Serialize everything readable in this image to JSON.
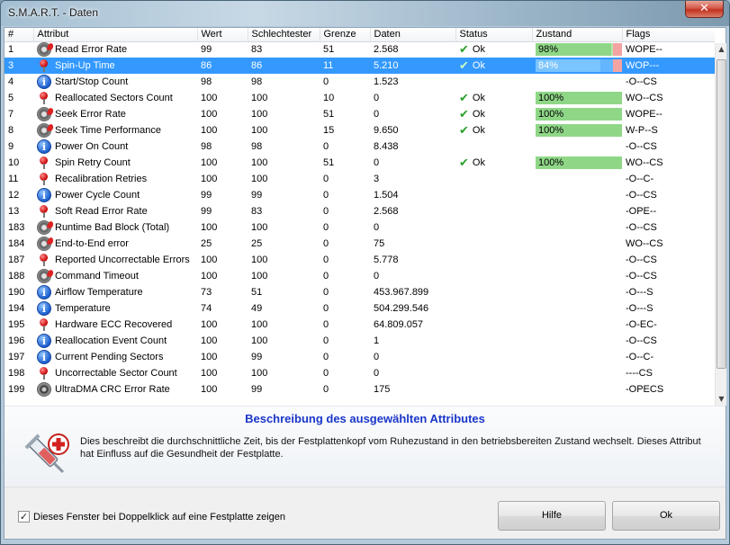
{
  "window": {
    "title": "S.M.A.R.T. - Daten",
    "close_label": "✕"
  },
  "table": {
    "columns": [
      "#",
      "Attribut",
      "Wert",
      "Schlechtester",
      "Grenze",
      "Daten",
      "Status",
      "Zustand",
      "Flags"
    ],
    "rows": [
      {
        "id": "1",
        "icon": "gear-icon",
        "attr": "Read Error Rate",
        "wert": "99",
        "worst": "83",
        "grenze": "51",
        "daten": "2.568",
        "status": "Ok",
        "zustand": "98%",
        "zustand_value": 0.98,
        "flags": "WOPE--"
      },
      {
        "id": "3",
        "icon": "pin-icon",
        "attr": "Spin-Up Time",
        "wert": "86",
        "worst": "86",
        "grenze": "11",
        "daten": "5.210",
        "status": "Ok",
        "zustand": "84%",
        "zustand_value": 0.84,
        "flags": "WOP---",
        "selected": true
      },
      {
        "id": "4",
        "icon": "info-icon",
        "attr": "Start/Stop Count",
        "wert": "98",
        "worst": "98",
        "grenze": "0",
        "daten": "1.523",
        "status": "",
        "zustand": "",
        "flags": "-O--CS"
      },
      {
        "id": "5",
        "icon": "pin-icon",
        "attr": "Reallocated Sectors Count",
        "wert": "100",
        "worst": "100",
        "grenze": "10",
        "daten": "0",
        "status": "Ok",
        "zustand": "100%",
        "zustand_value": 1.0,
        "flags": "WO--CS"
      },
      {
        "id": "7",
        "icon": "gear-icon",
        "attr": "Seek Error Rate",
        "wert": "100",
        "worst": "100",
        "grenze": "51",
        "daten": "0",
        "status": "Ok",
        "zustand": "100%",
        "zustand_value": 1.0,
        "flags": "WOPE--"
      },
      {
        "id": "8",
        "icon": "gear-icon",
        "attr": "Seek Time Performance",
        "wert": "100",
        "worst": "100",
        "grenze": "15",
        "daten": "9.650",
        "status": "Ok",
        "zustand": "100%",
        "zustand_value": 1.0,
        "flags": "W-P--S"
      },
      {
        "id": "9",
        "icon": "info-icon",
        "attr": "Power On Count",
        "wert": "98",
        "worst": "98",
        "grenze": "0",
        "daten": "8.438",
        "status": "",
        "zustand": "",
        "flags": "-O--CS"
      },
      {
        "id": "10",
        "icon": "pin-icon",
        "attr": "Spin Retry Count",
        "wert": "100",
        "worst": "100",
        "grenze": "51",
        "daten": "0",
        "status": "Ok",
        "zustand": "100%",
        "zustand_value": 1.0,
        "flags": "WO--CS"
      },
      {
        "id": "11",
        "icon": "pin-icon",
        "attr": "Recalibration Retries",
        "wert": "100",
        "worst": "100",
        "grenze": "0",
        "daten": "3",
        "status": "",
        "zustand": "",
        "flags": "-O--C-"
      },
      {
        "id": "12",
        "icon": "info-icon",
        "attr": "Power Cycle Count",
        "wert": "99",
        "worst": "99",
        "grenze": "0",
        "daten": "1.504",
        "status": "",
        "zustand": "",
        "flags": "-O--CS"
      },
      {
        "id": "13",
        "icon": "pin-icon",
        "attr": "Soft Read Error Rate",
        "wert": "99",
        "worst": "83",
        "grenze": "0",
        "daten": "2.568",
        "status": "",
        "zustand": "",
        "flags": "-OPE--"
      },
      {
        "id": "183",
        "icon": "gear-icon",
        "attr": "Runtime Bad Block (Total)",
        "wert": "100",
        "worst": "100",
        "grenze": "0",
        "daten": "0",
        "status": "",
        "zustand": "",
        "flags": "-O--CS"
      },
      {
        "id": "184",
        "icon": "gear-icon",
        "attr": "End-to-End error",
        "wert": "25",
        "worst": "25",
        "grenze": "0",
        "daten": "75",
        "status": "",
        "zustand": "",
        "flags": "WO--CS"
      },
      {
        "id": "187",
        "icon": "pin-icon",
        "attr": "Reported Uncorrectable Errors",
        "wert": "100",
        "worst": "100",
        "grenze": "0",
        "daten": "5.778",
        "status": "",
        "zustand": "",
        "flags": "-O--CS"
      },
      {
        "id": "188",
        "icon": "gear-icon",
        "attr": "Command Timeout",
        "wert": "100",
        "worst": "100",
        "grenze": "0",
        "daten": "0",
        "status": "",
        "zustand": "",
        "flags": "-O--CS"
      },
      {
        "id": "190",
        "icon": "info-icon",
        "attr": "Airflow Temperature",
        "wert": "73",
        "worst": "51",
        "grenze": "0",
        "daten": "453.967.899",
        "status": "",
        "zustand": "",
        "flags": "-O---S"
      },
      {
        "id": "194",
        "icon": "info-icon",
        "attr": "Temperature",
        "wert": "74",
        "worst": "49",
        "grenze": "0",
        "daten": "504.299.546",
        "status": "",
        "zustand": "",
        "flags": "-O---S"
      },
      {
        "id": "195",
        "icon": "pin-icon",
        "attr": "Hardware ECC Recovered",
        "wert": "100",
        "worst": "100",
        "grenze": "0",
        "daten": "64.809.057",
        "status": "",
        "zustand": "",
        "flags": "-O-EC-"
      },
      {
        "id": "196",
        "icon": "info-icon",
        "attr": "Reallocation Event Count",
        "wert": "100",
        "worst": "100",
        "grenze": "0",
        "daten": "1",
        "status": "",
        "zustand": "",
        "flags": "-O--CS"
      },
      {
        "id": "197",
        "icon": "info-icon",
        "attr": "Current Pending Sectors",
        "wert": "100",
        "worst": "99",
        "grenze": "0",
        "daten": "0",
        "status": "",
        "zustand": "",
        "flags": "-O--C-"
      },
      {
        "id": "198",
        "icon": "pin-icon",
        "attr": "Uncorrectable Sector Count",
        "wert": "100",
        "worst": "100",
        "grenze": "0",
        "daten": "0",
        "status": "",
        "zustand": "",
        "flags": "----CS"
      },
      {
        "id": "199",
        "icon": "disc-icon",
        "attr": "UltraDMA CRC Error Rate",
        "wert": "100",
        "worst": "99",
        "grenze": "0",
        "daten": "175",
        "status": "",
        "zustand": "",
        "flags": "-OPECS"
      }
    ]
  },
  "description": {
    "title": "Beschreibung des ausgewählten Attributes",
    "text": "Dies beschreibt die durchschnittliche Zeit, bis der Festplattenkopf vom Ruhezustand in den betriebsbereiten Zustand wechselt.  Dieses Attribut hat Einfluss auf die Gesundheit der Festplatte.",
    "icon": "syringe-icon"
  },
  "footer": {
    "checkbox_label": "Dieses Fenster bei Doppelklick auf eine Festplatte zeigen",
    "checkbox_checked": true,
    "help_label": "Hilfe",
    "ok_label": "Ok"
  },
  "colors": {
    "selection": "#3399ff",
    "bar_fill": "#8fd787",
    "bar_warn": "#f4a3a3",
    "desc_title": "#1a36c9",
    "ok_check": "#2aa02a"
  }
}
